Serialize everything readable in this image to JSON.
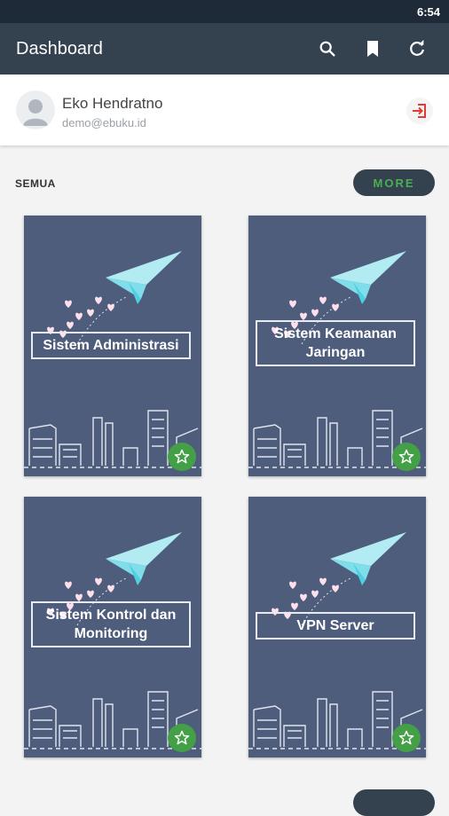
{
  "status_bar": {
    "time": "6:54"
  },
  "app_bar": {
    "title": "Dashboard"
  },
  "profile": {
    "name": "Eko Hendratno",
    "email": "demo@ebuku.id"
  },
  "section": {
    "title": "SEMUA",
    "more_label": "MORE"
  },
  "books": [
    {
      "title": "Sistem Administrasi"
    },
    {
      "title": "Sistem Keamanan Jaringan"
    },
    {
      "title": "Sistem Kontrol dan Monitoring"
    },
    {
      "title": "VPN Server"
    }
  ],
  "colors": {
    "app_bar": "#34414f",
    "card": "#4f5d7c",
    "accent_green": "#43a047",
    "logout_red": "#e53935"
  },
  "icons": [
    "search-icon",
    "bookmark-icon",
    "refresh-icon",
    "avatar-icon",
    "logout-icon",
    "star-icon",
    "paper-plane-icon"
  ]
}
